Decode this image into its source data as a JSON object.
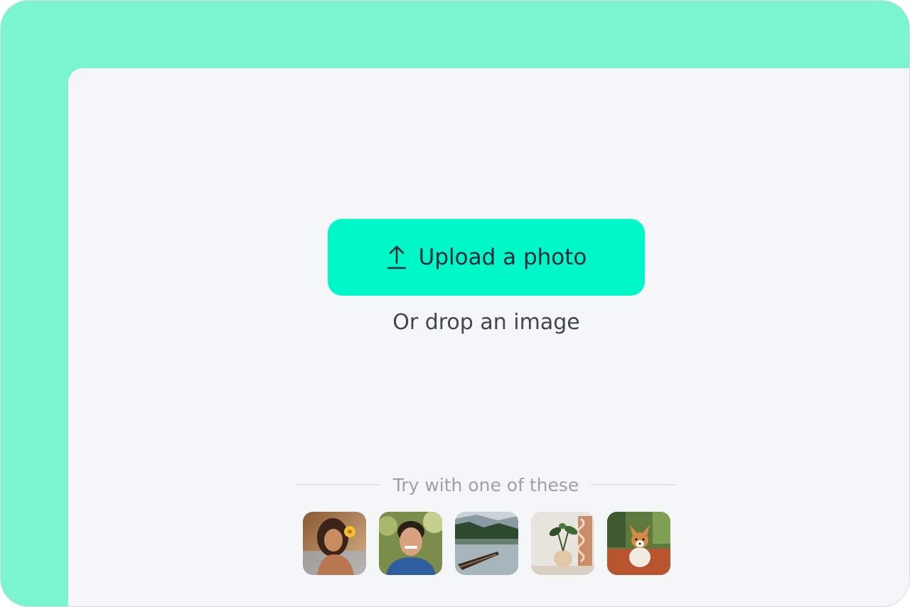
{
  "upload": {
    "label": "Upload a photo",
    "icon": "upload-arrow-icon",
    "accent": "#00f7c8"
  },
  "drop": {
    "label": "Or drop an image"
  },
  "samples": {
    "heading": "Try with one of these",
    "items": [
      {
        "icon": "sample-portrait-woman-image"
      },
      {
        "icon": "sample-portrait-man-image"
      },
      {
        "icon": "sample-boat-lake-image"
      },
      {
        "icon": "sample-plant-vase-image"
      },
      {
        "icon": "sample-corgi-dog-image"
      }
    ]
  },
  "colors": {
    "frame": "#7af5cf",
    "panel": "#f5f6f8"
  }
}
